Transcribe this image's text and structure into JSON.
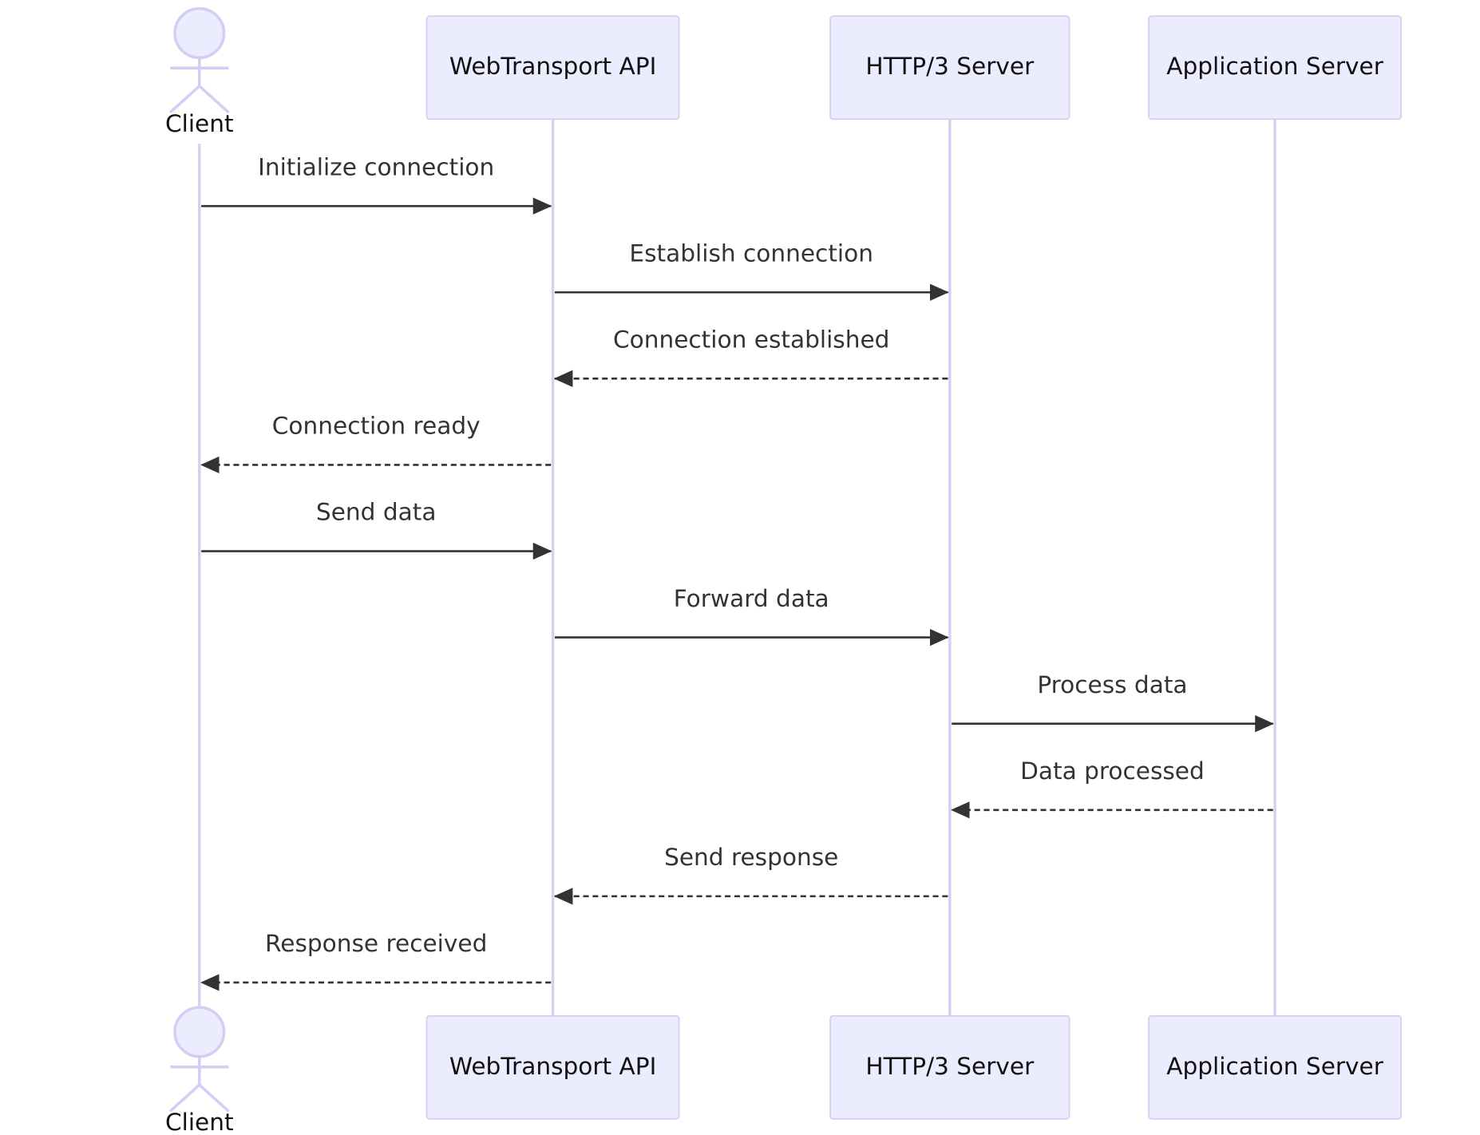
{
  "diagram": {
    "type": "sequence",
    "colors": {
      "participant_fill": "#ececff",
      "participant_border": "#d6cdf3",
      "lifeline": "#d8d0f0",
      "arrow": "#333333"
    },
    "participants": [
      {
        "id": "client",
        "label": "Client",
        "kind": "actor"
      },
      {
        "id": "webtransport",
        "label": "WebTransport API",
        "kind": "participant"
      },
      {
        "id": "http3",
        "label": "HTTP/3 Server",
        "kind": "participant"
      },
      {
        "id": "app",
        "label": "Application Server",
        "kind": "participant"
      }
    ],
    "messages": [
      {
        "from": 0,
        "to": 1,
        "label": "Initialize connection",
        "style": "solid"
      },
      {
        "from": 1,
        "to": 2,
        "label": "Establish connection",
        "style": "solid"
      },
      {
        "from": 2,
        "to": 1,
        "label": "Connection established",
        "style": "dashed"
      },
      {
        "from": 1,
        "to": 0,
        "label": "Connection ready",
        "style": "dashed"
      },
      {
        "from": 0,
        "to": 1,
        "label": "Send data",
        "style": "solid"
      },
      {
        "from": 1,
        "to": 2,
        "label": "Forward data",
        "style": "solid"
      },
      {
        "from": 2,
        "to": 3,
        "label": "Process data",
        "style": "solid"
      },
      {
        "from": 3,
        "to": 2,
        "label": "Data processed",
        "style": "dashed"
      },
      {
        "from": 2,
        "to": 1,
        "label": "Send response",
        "style": "dashed"
      },
      {
        "from": 1,
        "to": 0,
        "label": "Response received",
        "style": "dashed"
      }
    ]
  }
}
